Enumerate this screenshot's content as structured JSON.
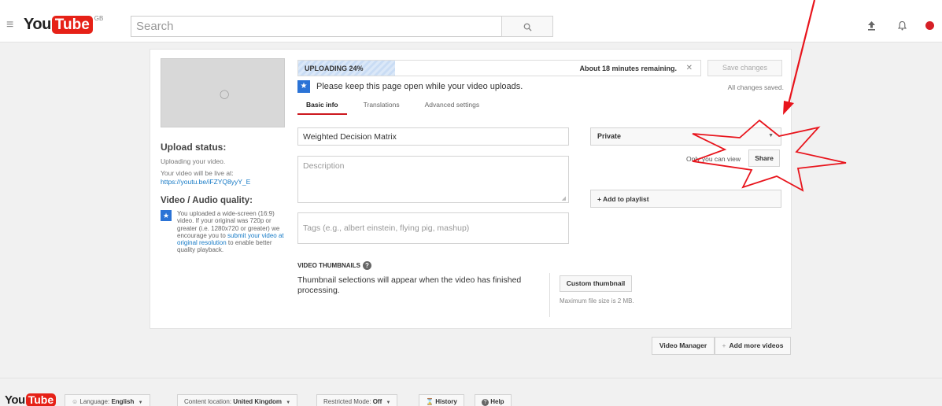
{
  "topbar": {
    "logo_you": "You",
    "logo_tube": "Tube",
    "region": "GB",
    "search_placeholder": "Search"
  },
  "upload": {
    "progress_label": "UPLOADING 24%",
    "progress_fraction": 0.24,
    "remaining": "About 18 minutes remaining.",
    "save_label": "Save changes",
    "saved_status": "All changes saved.",
    "keep_open": "Please keep this page open while your video uploads."
  },
  "tabs": [
    {
      "label": "Basic info"
    },
    {
      "label": "Translations"
    },
    {
      "label": "Advanced settings"
    }
  ],
  "left": {
    "status_heading": "Upload status:",
    "status_text": "Uploading your video.",
    "live_text": "Your video will be live at:",
    "live_url": "https://youtu.be/iFZYQ8yyY_E",
    "quality_heading": "Video / Audio quality:",
    "quality_pre": "You uploaded a wide-screen (16:9) video. If your original was 720p or greater (i.e. 1280x720 or greater) we encourage you to ",
    "quality_link": "submit your video at original resolution",
    "quality_post": " to enable better quality playback."
  },
  "form": {
    "title_value": "Weighted Decision Matrix",
    "description_placeholder": "Description",
    "tags_placeholder": "Tags (e.g., albert einstein, flying pig, mashup)"
  },
  "privacy": {
    "selected": "Private",
    "only_you": "Only you can view",
    "share_label": "Share",
    "playlist_label": "+ Add to playlist"
  },
  "thumbnails": {
    "heading": "VIDEO THUMBNAILS",
    "message": "Thumbnail selections will appear when the video has finished processing.",
    "custom_label": "Custom thumbnail",
    "max_size": "Maximum file size is 2 MB."
  },
  "actions": {
    "video_manager": "Video Manager",
    "add_more": "Add more videos"
  },
  "footer": {
    "language_prefix": "Language: ",
    "language_value": "English",
    "location_prefix": "Content location: ",
    "location_value": "United Kingdom",
    "restricted_prefix": "Restricted Mode: ",
    "restricted_value": "Off",
    "history": "History",
    "help": "Help"
  },
  "colors": {
    "youtube_red": "#e62117",
    "annotation_red": "#e8141c",
    "tab_underline": "#cc181e",
    "link_blue": "#167ac6"
  }
}
